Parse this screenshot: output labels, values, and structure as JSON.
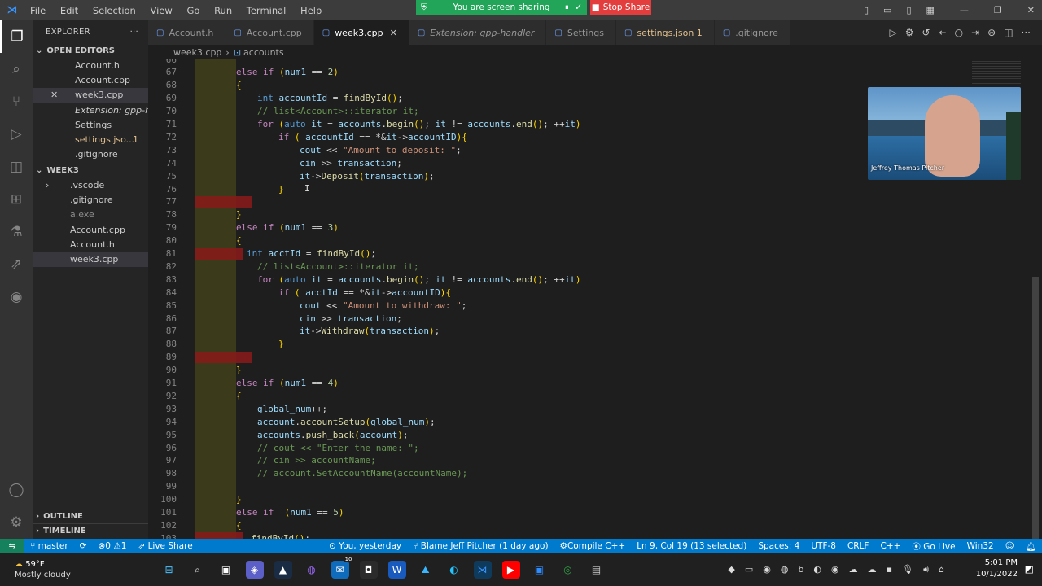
{
  "menu": [
    "File",
    "Edit",
    "Selection",
    "View",
    "Go",
    "Run",
    "Terminal",
    "Help"
  ],
  "share": {
    "sharing_label": "You are screen sharing",
    "stop_label": "Stop Share"
  },
  "sidebar": {
    "explorer_label": "EXPLORER",
    "open_editors_label": "OPEN EDITORS",
    "open_editors": [
      {
        "label": "Account.h"
      },
      {
        "label": "Account.cpp"
      },
      {
        "label": "week3.cpp"
      },
      {
        "label": "Extension: gpp-h..."
      },
      {
        "label": "Settings"
      },
      {
        "label": "settings.jso...",
        "badge": "1"
      },
      {
        "label": ".gitignore"
      }
    ],
    "folder_label": "WEEK3",
    "folder_items": [
      {
        "label": ".vscode"
      },
      {
        "label": ".gitignore"
      },
      {
        "label": "a.exe"
      },
      {
        "label": "Account.cpp"
      },
      {
        "label": "Account.h"
      },
      {
        "label": "week3.cpp"
      }
    ],
    "outline_label": "OUTLINE",
    "timeline_label": "TIMELINE"
  },
  "tabs": [
    {
      "label": "Account.h"
    },
    {
      "label": "Account.cpp"
    },
    {
      "label": "week3.cpp"
    },
    {
      "label": "Extension: gpp-handler"
    },
    {
      "label": "Settings"
    },
    {
      "label": "settings.json 1"
    },
    {
      "label": ".gitignore"
    }
  ],
  "breadcrumb": {
    "file": "week3.cpp",
    "symbol": "accounts"
  },
  "code_lines": [
    {
      "n": "66",
      "text": ""
    },
    {
      "n": "67",
      "text": "else if (num1 == 2)"
    },
    {
      "n": "68",
      "text": "{"
    },
    {
      "n": "69",
      "text": "int accountId = findById();"
    },
    {
      "n": "70",
      "text": "// list<Account>::iterator it;"
    },
    {
      "n": "71",
      "text": "for (auto it = accounts.begin(); it != accounts.end(); ++it)"
    },
    {
      "n": "72",
      "text": "if ( accountId == *&it->accountID){"
    },
    {
      "n": "73",
      "text": "cout << \"Amount to deposit: \";"
    },
    {
      "n": "74",
      "text": "cin >> transaction;"
    },
    {
      "n": "75",
      "text": "it->Deposit(transaction);"
    },
    {
      "n": "76",
      "text": "}"
    },
    {
      "n": "77",
      "text": ""
    },
    {
      "n": "78",
      "text": "}"
    },
    {
      "n": "79",
      "text": "else if (num1 == 3)"
    },
    {
      "n": "80",
      "text": "{"
    },
    {
      "n": "81",
      "text": "int acctId = findById();"
    },
    {
      "n": "82",
      "text": "// list<Account>::iterator it;"
    },
    {
      "n": "83",
      "text": "for (auto it = accounts.begin(); it != accounts.end(); ++it)"
    },
    {
      "n": "84",
      "text": "if ( acctId == *&it->accountID){"
    },
    {
      "n": "85",
      "text": "cout << \"Amount to withdraw: \";"
    },
    {
      "n": "86",
      "text": "cin >> transaction;"
    },
    {
      "n": "87",
      "text": "it->Withdraw(transaction);"
    },
    {
      "n": "88",
      "text": "}"
    },
    {
      "n": "89",
      "text": ""
    },
    {
      "n": "90",
      "text": "}"
    },
    {
      "n": "91",
      "text": "else if (num1 == 4)"
    },
    {
      "n": "92",
      "text": "{"
    },
    {
      "n": "93",
      "text": "global_num++;"
    },
    {
      "n": "94",
      "text": "account.accountSetup(global_num);"
    },
    {
      "n": "95",
      "text": "accounts.push_back(account);"
    },
    {
      "n": "96",
      "text": "// cout << \"Enter the name: \";"
    },
    {
      "n": "97",
      "text": "// cin >> accountName;"
    },
    {
      "n": "98",
      "text": "// account.SetAccountName(accountName);"
    },
    {
      "n": "99",
      "text": ""
    },
    {
      "n": "100",
      "text": "}"
    },
    {
      "n": "101",
      "text": "else if  (num1 == 5)"
    },
    {
      "n": "102",
      "text": "{"
    },
    {
      "n": "103",
      "text": "findById();"
    }
  ],
  "webcam": {
    "name": "Jeffrey Thomas Pitcher"
  },
  "status": {
    "branch": "master",
    "problems_errors": "0",
    "problems_warnings": "1",
    "live_share": "Live Share",
    "blame_you": "You, yesterday",
    "blame": "Blame Jeff Pitcher (1 day ago)",
    "compile": "Compile C++",
    "position": "Ln 9, Col 19 (13 selected)",
    "spaces": "Spaces: 4",
    "encoding": "UTF-8",
    "eol": "CRLF",
    "language": "C++",
    "golive": "Go Live",
    "platform": "Win32"
  },
  "taskbar": {
    "temp": "59°F",
    "weather": "Mostly cloudy",
    "time": "5:01 PM",
    "date": "10/1/2022",
    "mail_badge": "10"
  }
}
